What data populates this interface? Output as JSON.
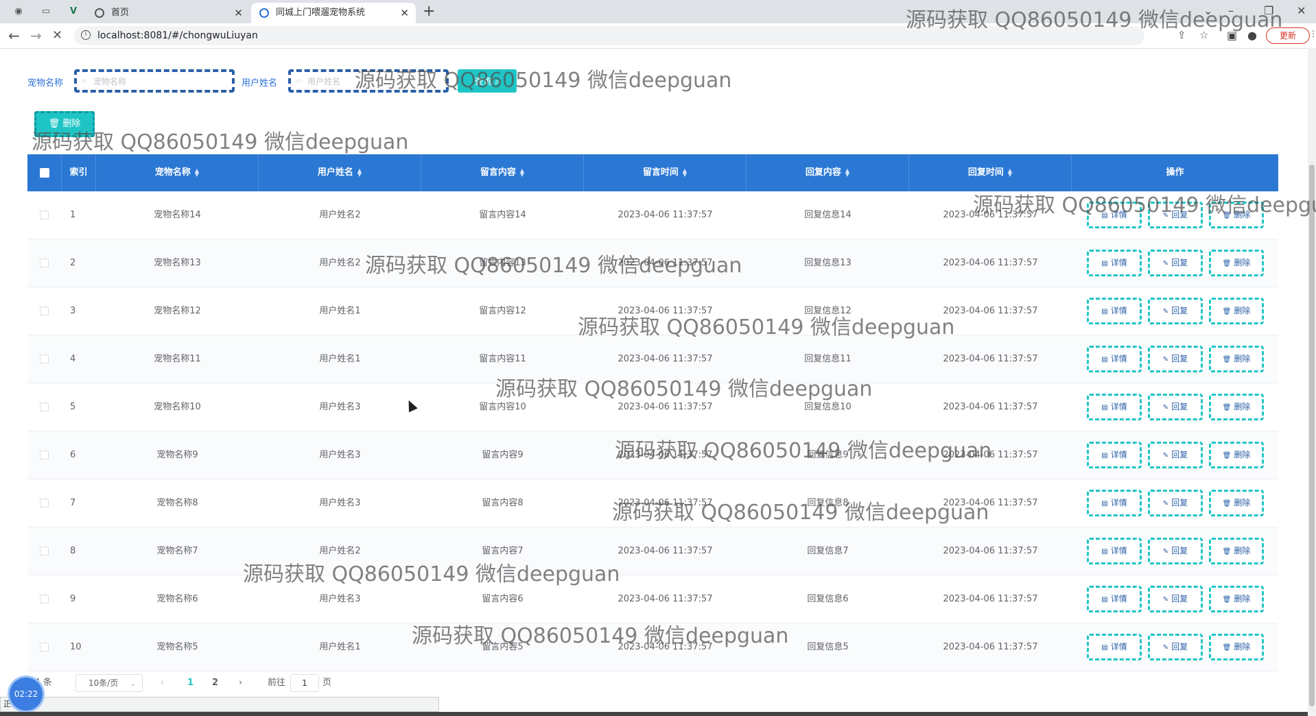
{
  "browser": {
    "tabs": [
      {
        "title": "首页"
      },
      {
        "title": "同城上门喂遛宠物系统"
      }
    ],
    "url": "localhost:8081/#/chongwuLiuyan",
    "update_label": "更新"
  },
  "search": {
    "pet_label": "宠物名称",
    "pet_placeholder": "宠物名称",
    "user_label": "用户姓名",
    "user_placeholder": "用户姓名",
    "query_label": "查询"
  },
  "toolbar": {
    "delete_label": "删除"
  },
  "table": {
    "columns": [
      "索引",
      "宠物名称",
      "用户姓名",
      "留言内容",
      "留言时间",
      "回复内容",
      "回复时间",
      "操作"
    ],
    "rows": [
      {
        "index": "1",
        "pet": "宠物名称14",
        "user": "用户姓名2",
        "content": "留言内容14",
        "time": "2023-04-06 11:37:57",
        "reply": "回复信息14",
        "reply_time": "2023-04-06 11:37:57"
      },
      {
        "index": "2",
        "pet": "宠物名称13",
        "user": "用户姓名2",
        "content": "留言内容13",
        "time": "2023-04-06 11:37:57",
        "reply": "回复信息13",
        "reply_time": "2023-04-06 11:37:57"
      },
      {
        "index": "3",
        "pet": "宠物名称12",
        "user": "用户姓名1",
        "content": "留言内容12",
        "time": "2023-04-06 11:37:57",
        "reply": "回复信息12",
        "reply_time": "2023-04-06 11:37:57"
      },
      {
        "index": "4",
        "pet": "宠物名称11",
        "user": "用户姓名1",
        "content": "留言内容11",
        "time": "2023-04-06 11:37:57",
        "reply": "回复信息11",
        "reply_time": "2023-04-06 11:37:57"
      },
      {
        "index": "5",
        "pet": "宠物名称10",
        "user": "用户姓名3",
        "content": "留言内容10",
        "time": "2023-04-06 11:37:57",
        "reply": "回复信息10",
        "reply_time": "2023-04-06 11:37:57"
      },
      {
        "index": "6",
        "pet": "宠物名称9",
        "user": "用户姓名3",
        "content": "留言内容9",
        "time": "2023-04-06 11:37:57",
        "reply": "回复信息9",
        "reply_time": "2023-04-06 11:37:57"
      },
      {
        "index": "7",
        "pet": "宠物名称8",
        "user": "用户姓名3",
        "content": "留言内容8",
        "time": "2023-04-06 11:37:57",
        "reply": "回复信息8",
        "reply_time": "2023-04-06 11:37:57"
      },
      {
        "index": "8",
        "pet": "宠物名称7",
        "user": "用户姓名2",
        "content": "留言内容7",
        "time": "2023-04-06 11:37:57",
        "reply": "回复信息7",
        "reply_time": "2023-04-06 11:37:57"
      },
      {
        "index": "9",
        "pet": "宠物名称6",
        "user": "用户姓名3",
        "content": "留言内容6",
        "time": "2023-04-06 11:37:57",
        "reply": "回复信息6",
        "reply_time": "2023-04-06 11:37:57"
      },
      {
        "index": "10",
        "pet": "宠物名称5",
        "user": "用户姓名1",
        "content": "留言内容5",
        "time": "2023-04-06 11:37:57",
        "reply": "回复信息5",
        "reply_time": "2023-04-06 11:37:57"
      }
    ],
    "actions": {
      "detail": "详情",
      "reply": "回复",
      "delete": "删除"
    }
  },
  "pagination": {
    "total": "14 条",
    "page_size": "10条/页",
    "pages": [
      "1",
      "2"
    ],
    "goto_label": "前往",
    "goto_value": "1",
    "page_suffix": "页"
  },
  "overlay": {
    "watermark": "源码获取 QQ86050149 微信deepguan",
    "timer": "02:22",
    "status": "正在..."
  },
  "colors": {
    "header_bg": "#2a78d4",
    "accent": "#1fc5c5",
    "label_blue": "#2b6fd6"
  }
}
